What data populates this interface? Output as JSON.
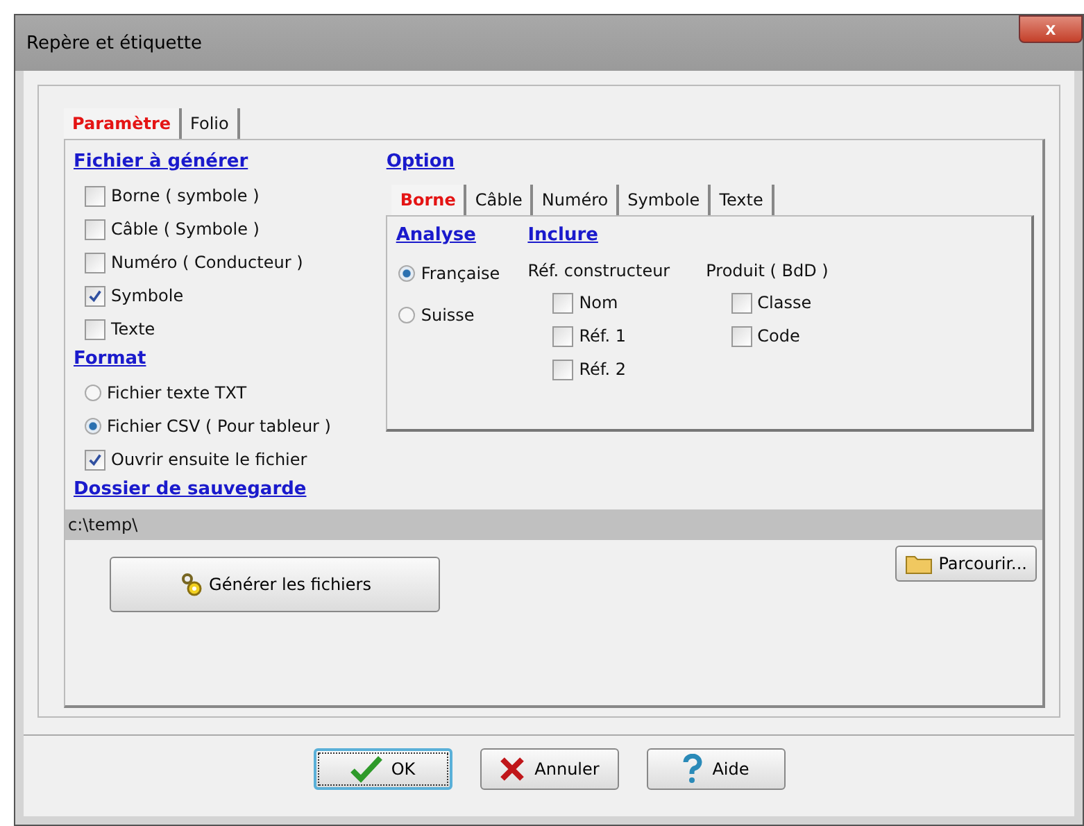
{
  "window": {
    "title": "Repère et étiquette",
    "close": "x"
  },
  "tabs": [
    {
      "label": "Paramètre",
      "selected": true
    },
    {
      "label": "Folio",
      "selected": false
    }
  ],
  "files": {
    "heading": "Fichier à générer",
    "items": [
      {
        "label": "Borne ( symbole )",
        "checked": false
      },
      {
        "label": "Câble ( Symbole )",
        "checked": false
      },
      {
        "label": "Numéro ( Conducteur )",
        "checked": false
      },
      {
        "label": "Symbole",
        "checked": true
      },
      {
        "label": "Texte",
        "checked": false
      }
    ]
  },
  "format": {
    "heading": "Format",
    "options": [
      {
        "label": "Fichier texte TXT",
        "selected": false
      },
      {
        "label": "Fichier CSV ( Pour tableur )",
        "selected": true
      }
    ],
    "open_after": {
      "label": "Ouvrir ensuite le fichier",
      "checked": true
    }
  },
  "option": {
    "heading": "Option",
    "tabs": [
      {
        "label": "Borne",
        "selected": true
      },
      {
        "label": "Câble",
        "selected": false
      },
      {
        "label": "Numéro",
        "selected": false
      },
      {
        "label": "Symbole",
        "selected": false
      },
      {
        "label": "Texte",
        "selected": false
      }
    ],
    "analyse": {
      "heading": "Analyse",
      "options": [
        {
          "label": "Française",
          "selected": true
        },
        {
          "label": "Suisse",
          "selected": false
        }
      ]
    },
    "inclure": {
      "heading": "Inclure",
      "groups": [
        {
          "label": "Réf. constructeur",
          "items": [
            {
              "label": "Nom",
              "checked": false
            },
            {
              "label": "Réf. 1",
              "checked": false
            },
            {
              "label": "Réf. 2",
              "checked": false
            }
          ]
        },
        {
          "label": "Produit ( BdD )",
          "items": [
            {
              "label": "Classe",
              "checked": false
            },
            {
              "label": "Code",
              "checked": false
            }
          ]
        }
      ]
    }
  },
  "save_folder": {
    "heading": "Dossier de sauvegarde",
    "value": "c:\\temp\\"
  },
  "generate_button": "Générer les fichiers",
  "browse_button": "Parcourir...",
  "buttons": [
    {
      "kind": "ok",
      "label": "OK",
      "focused": true
    },
    {
      "kind": "cancel",
      "label": "Annuler",
      "focused": false
    },
    {
      "kind": "help",
      "label": "Aide",
      "focused": false
    }
  ]
}
